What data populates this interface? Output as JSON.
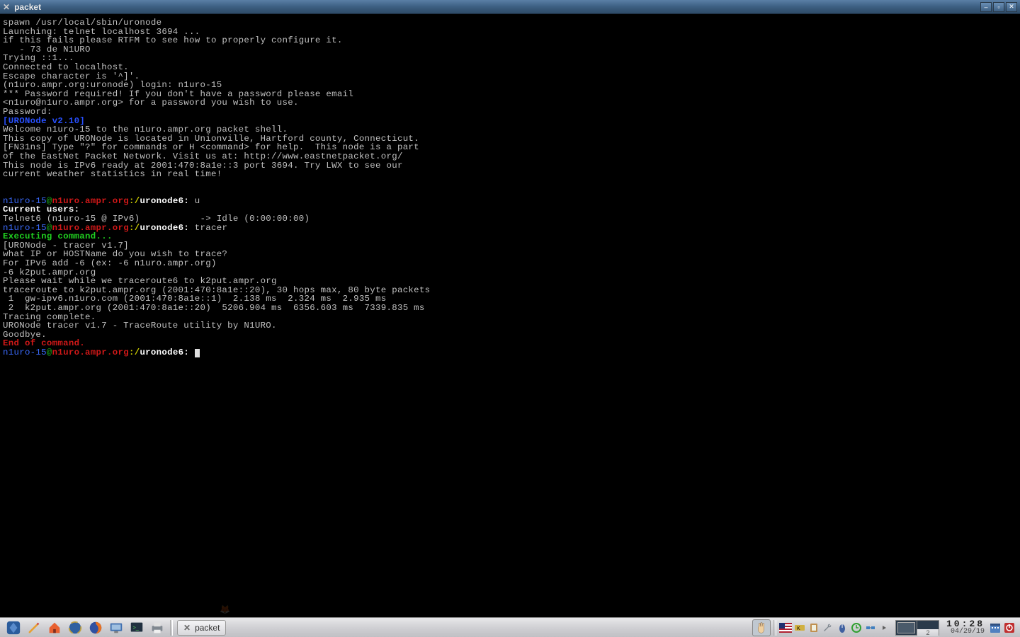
{
  "window": {
    "title": "packet"
  },
  "terminal": {
    "lines": [
      {
        "segments": [
          {
            "cls": "c-gray",
            "text": "spawn /usr/local/sbin/uronode"
          }
        ]
      },
      {
        "segments": [
          {
            "cls": "c-gray",
            "text": "Launching: telnet localhost 3694 ..."
          }
        ]
      },
      {
        "segments": [
          {
            "cls": "c-gray",
            "text": "if this fails please RTFM to see how to properly configure it."
          }
        ]
      },
      {
        "segments": [
          {
            "cls": "c-gray",
            "text": "   - 73 de N1URO"
          }
        ]
      },
      {
        "segments": [
          {
            "cls": "c-gray",
            "text": "Trying ::1..."
          }
        ]
      },
      {
        "segments": [
          {
            "cls": "c-gray",
            "text": "Connected to localhost."
          }
        ]
      },
      {
        "segments": [
          {
            "cls": "c-gray",
            "text": "Escape character is '^]'."
          }
        ]
      },
      {
        "segments": [
          {
            "cls": "c-gray",
            "text": "(n1uro.ampr.org:uronode) login: n1uro-15"
          }
        ]
      },
      {
        "segments": [
          {
            "cls": "c-gray",
            "text": "*** Password required! If you don't have a password please email"
          }
        ]
      },
      {
        "segments": [
          {
            "cls": "c-gray",
            "text": "<n1uro@n1uro.ampr.org> for a password you wish to use."
          }
        ]
      },
      {
        "segments": [
          {
            "cls": "c-gray",
            "text": "Password:"
          }
        ]
      },
      {
        "segments": [
          {
            "cls": "c-bluebold",
            "text": "[URONode v2.10]"
          }
        ]
      },
      {
        "segments": [
          {
            "cls": "c-gray",
            "text": "Welcome n1uro-15 to the n1uro.ampr.org packet shell."
          }
        ]
      },
      {
        "segments": [
          {
            "cls": "c-gray",
            "text": "This copy of URONode is located in Unionville, Hartford county, Connecticut."
          }
        ]
      },
      {
        "segments": [
          {
            "cls": "c-gray",
            "text": "[FN31ns] Type \"?\" for commands or H <command> for help.  This node is a part"
          }
        ]
      },
      {
        "segments": [
          {
            "cls": "c-gray",
            "text": "of the EastNet Packet Network. Visit us at: http://www.eastnetpacket.org/"
          }
        ]
      },
      {
        "segments": [
          {
            "cls": "c-gray",
            "text": "This node is IPv6 ready at 2001:470:8a1e::3 port 3694. Try LWX to see our"
          }
        ]
      },
      {
        "segments": [
          {
            "cls": "c-gray",
            "text": "current weather statistics in real time!"
          }
        ]
      },
      {
        "segments": []
      },
      {
        "segments": []
      },
      {
        "segments": [
          {
            "cls": "c-blue",
            "text": "n1uro-15"
          },
          {
            "cls": "c-greendk",
            "text": "@"
          },
          {
            "cls": "c-red",
            "text": "n1uro.ampr.org"
          },
          {
            "cls": "c-yellow",
            "text": ":/"
          },
          {
            "cls": "c-white",
            "text": "uronode6: "
          },
          {
            "cls": "c-gray",
            "text": "u"
          }
        ]
      },
      {
        "segments": [
          {
            "cls": "c-white",
            "text": "Current users:"
          }
        ]
      },
      {
        "segments": [
          {
            "cls": "c-gray",
            "text": "Telnet6 (n1uro-15 @ IPv6)           -> Idle (0:00:00:00)"
          }
        ]
      },
      {
        "segments": [
          {
            "cls": "c-blue",
            "text": "n1uro-15"
          },
          {
            "cls": "c-greendk",
            "text": "@"
          },
          {
            "cls": "c-red",
            "text": "n1uro.ampr.org"
          },
          {
            "cls": "c-yellow",
            "text": ":/"
          },
          {
            "cls": "c-white",
            "text": "uronode6: "
          },
          {
            "cls": "c-gray",
            "text": "tracer"
          }
        ]
      },
      {
        "segments": [
          {
            "cls": "c-green",
            "text": "Executing command..."
          }
        ]
      },
      {
        "segments": [
          {
            "cls": "c-gray",
            "text": "[URONode - tracer v1.7]"
          }
        ]
      },
      {
        "segments": [
          {
            "cls": "c-gray",
            "text": "what IP or HOSTName do you wish to trace?"
          }
        ]
      },
      {
        "segments": [
          {
            "cls": "c-gray",
            "text": "For IPv6 add -6 (ex: -6 n1uro.ampr.org)"
          }
        ]
      },
      {
        "segments": [
          {
            "cls": "c-gray",
            "text": "-6 k2put.ampr.org"
          }
        ]
      },
      {
        "segments": [
          {
            "cls": "c-gray",
            "text": "Please wait while we traceroute6 to k2put.ampr.org"
          }
        ]
      },
      {
        "segments": [
          {
            "cls": "c-gray",
            "text": "traceroute to k2put.ampr.org (2001:470:8a1e::20), 30 hops max, 80 byte packets"
          }
        ]
      },
      {
        "segments": [
          {
            "cls": "c-gray",
            "text": " 1  gw-ipv6.n1uro.com (2001:470:8a1e::1)  2.138 ms  2.324 ms  2.935 ms"
          }
        ]
      },
      {
        "segments": [
          {
            "cls": "c-gray",
            "text": " 2  k2put.ampr.org (2001:470:8a1e::20)  5206.904 ms  6356.603 ms  7339.835 ms"
          }
        ]
      },
      {
        "segments": [
          {
            "cls": "c-gray",
            "text": "Tracing complete."
          }
        ]
      },
      {
        "segments": [
          {
            "cls": "c-gray",
            "text": "URONode tracer v1.7 - TraceRoute utility by N1URO."
          }
        ]
      },
      {
        "segments": [
          {
            "cls": "c-gray",
            "text": "Goodbye."
          }
        ]
      },
      {
        "segments": [
          {
            "cls": "c-red",
            "text": "End of command."
          }
        ]
      },
      {
        "segments": [
          {
            "cls": "c-blue",
            "text": "n1uro-15"
          },
          {
            "cls": "c-greendk",
            "text": "@"
          },
          {
            "cls": "c-red",
            "text": "n1uro.ampr.org"
          },
          {
            "cls": "c-yellow",
            "text": ":/"
          },
          {
            "cls": "c-white",
            "text": "uronode6: "
          },
          {
            "cls": "cursor",
            "text": ""
          }
        ]
      }
    ]
  },
  "taskbar": {
    "task_label": "packet",
    "desktop_count": "2",
    "clock_time": "10:28",
    "clock_date": "04/29/19"
  },
  "icons": {
    "trinity": "trinity-menu-icon",
    "pencil": "pencil-icon",
    "home": "home-icon",
    "konq": "globe-icon",
    "firefox": "firefox-icon",
    "pc": "desktop-icon",
    "konsole": "terminal-icon",
    "printer": "printer-icon",
    "ffghost": "firefox-icon",
    "hand": "pan-hand-icon",
    "flag": "usflag-icon",
    "kb": "keyboard-icon",
    "clip": "clipboard-icon",
    "wrench": "wrench-icon",
    "mouse": "mouse-icon",
    "update": "update-icon",
    "net": "network-icon",
    "arrow": "arrow-icon",
    "cal": "calendar-icon",
    "power": "power-icon"
  }
}
